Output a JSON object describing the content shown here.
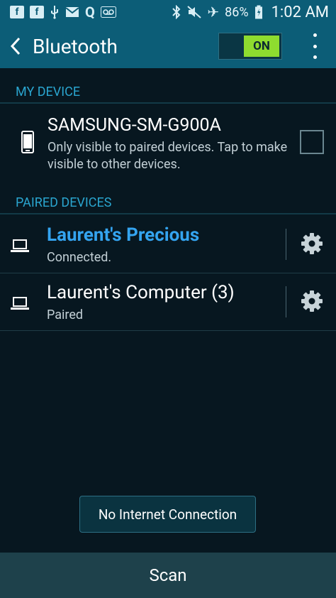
{
  "status_bar": {
    "left_icons": [
      "facebook-icon",
      "facebook-icon",
      "usb-icon",
      "mail-icon",
      "quora-icon",
      "voicemail-icon"
    ],
    "right_icons": [
      "bluetooth-icon",
      "mute-icon",
      "airplane-mode-icon"
    ],
    "battery_percent": "86%",
    "time": "1:02 AM"
  },
  "app_bar": {
    "title": "Bluetooth",
    "toggle_label": "ON"
  },
  "my_device": {
    "header": "MY DEVICE",
    "name": "SAMSUNG-SM-G900A",
    "description": "Only visible to paired devices. Tap to make visible to other devices."
  },
  "paired_devices": {
    "header": "PAIRED DEVICES",
    "items": [
      {
        "name": "Laurent's Precious",
        "status": "Connected."
      },
      {
        "name": "Laurent's Computer (3)",
        "status": "Paired"
      }
    ]
  },
  "toast": {
    "text": "No Internet Connection"
  },
  "scan_button": {
    "label": "Scan"
  },
  "colors": {
    "status_bar_bg": "#0c5d77",
    "background": "#071720",
    "section_header": "#2aa5cf",
    "toggle_on": "#8edc2f",
    "connected_name": "#34a4f0"
  }
}
